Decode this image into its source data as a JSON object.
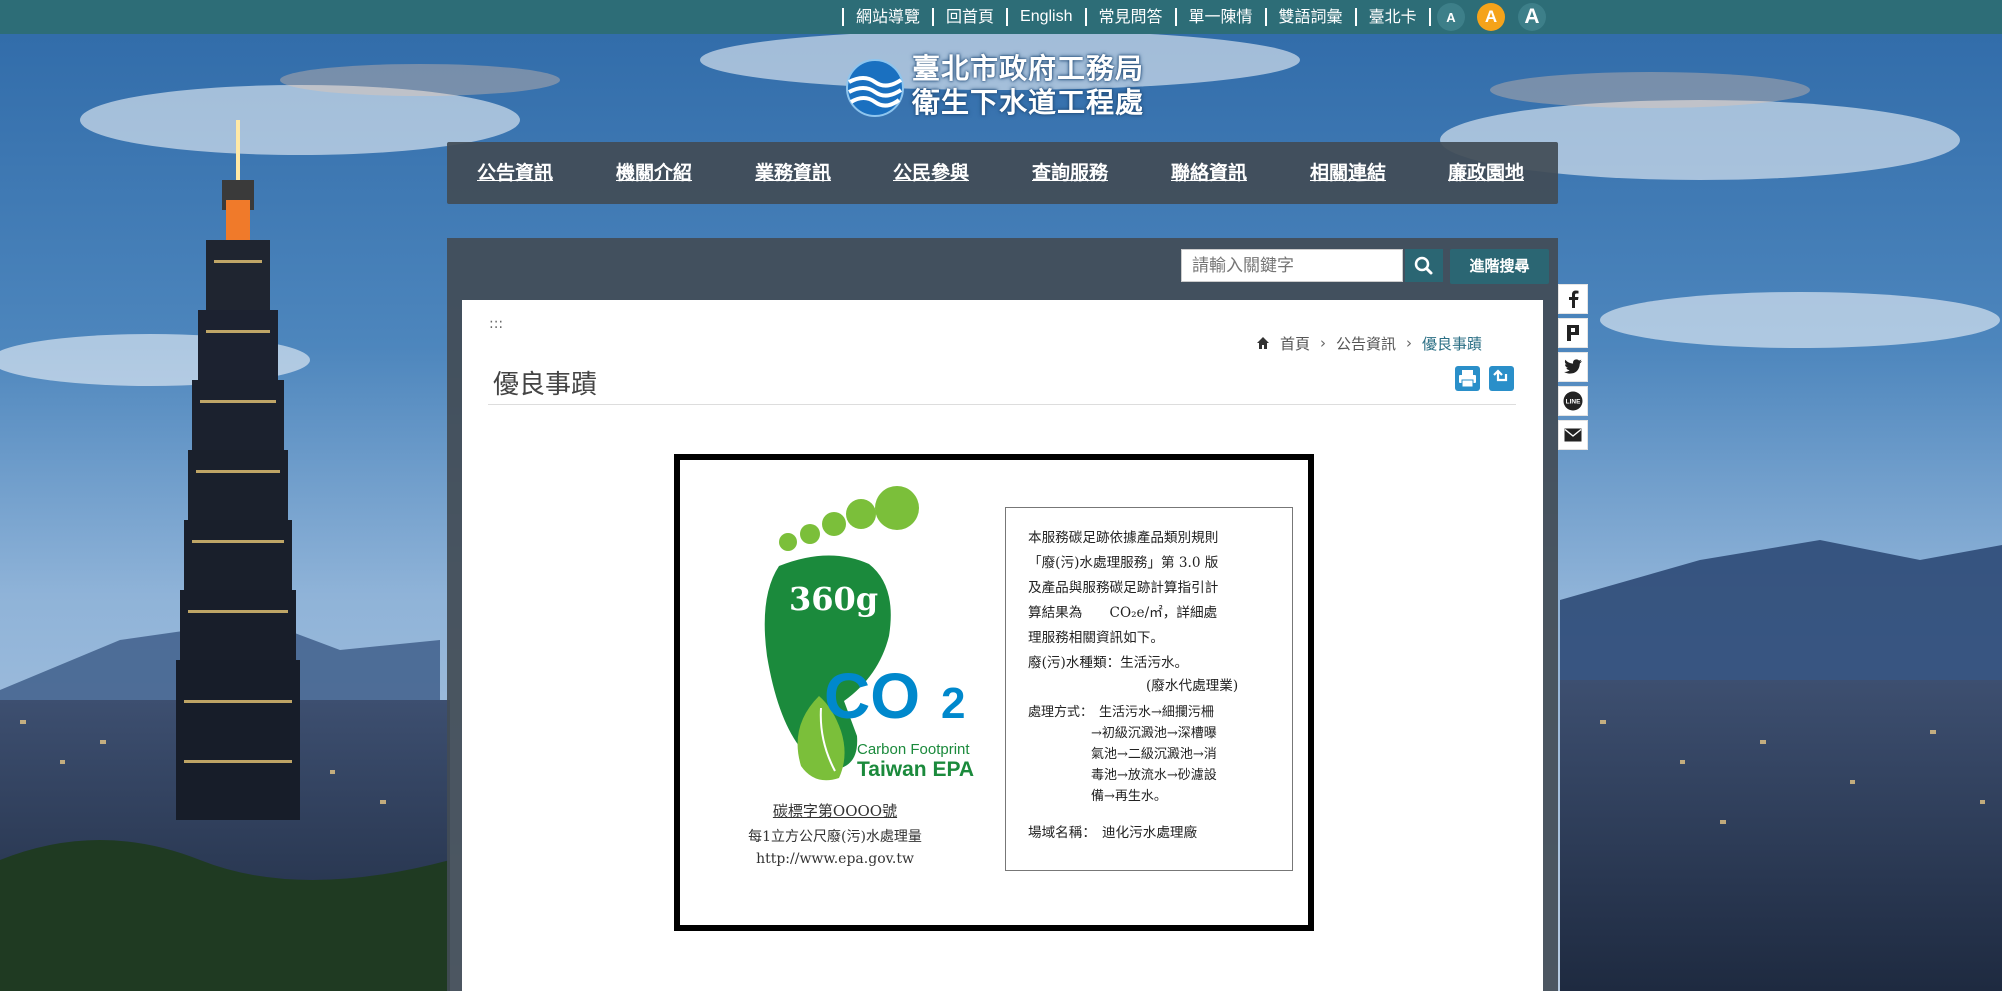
{
  "top_links": [
    "網站導覽",
    "回首頁",
    "English",
    "常見問答",
    "單一陳情",
    "雙語詞彙",
    "臺北卡"
  ],
  "font_size_buttons": [
    "A",
    "A",
    "A"
  ],
  "logo": {
    "line1": "臺北市政府工務局",
    "line2": "衛生下水道工程處"
  },
  "nav": [
    "公告資訊",
    "機關介紹",
    "業務資訊",
    "公民參與",
    "查詢服務",
    "聯絡資訊",
    "相關連結",
    "廉政園地"
  ],
  "search": {
    "placeholder": "請輸入關鍵字",
    "advanced_label": "進階搜尋"
  },
  "accesskey": ":::",
  "breadcrumb": [
    "首頁",
    "公告資訊",
    "優良事蹟"
  ],
  "page_title": "優良事蹟",
  "certificate": {
    "footprint_value": "360g",
    "co2": "CO",
    "co2_sub": "2",
    "label_line1": "Carbon Footprint",
    "label_line2": "Taiwan EPA",
    "left_lines": [
      "碳標字第OOOO號",
      "每1立方公尺廢(污)水處理量",
      "http://www.epa.gov.tw"
    ],
    "info": {
      "para1": [
        "本服務碳足跡依據產品類別規則",
        "「廢(污)水處理服務」第 3.0 版",
        "及產品與服務碳足跡計算指引計",
        "算結果為　　CO₂e/㎡，詳細處",
        "理服務相關資訊如下。"
      ],
      "type_label": "廢(污)水種類：",
      "type_value": "生活污水。",
      "type_note": "(廢水代處理業)",
      "method_label": "處理方式：",
      "method_lines": [
        "生活污水→細攔污柵",
        "→初級沉澱池→深槽曝",
        "氣池→二級沉澱池→消",
        "毒池→放流水→砂濾設",
        "備→再生水。"
      ],
      "site_label": "場域名稱：",
      "site_value": "迪化污水處理廠"
    }
  },
  "colors": {
    "topbar": "#2d6d77",
    "accent_orange": "#f5a31a",
    "nav_bg": "#424c56",
    "footprint_green": "#1b8a3c",
    "co2_blue": "#0088cc"
  },
  "social_icons": [
    "facebook-icon",
    "plurk-icon",
    "twitter-icon",
    "line-icon",
    "email-icon"
  ]
}
